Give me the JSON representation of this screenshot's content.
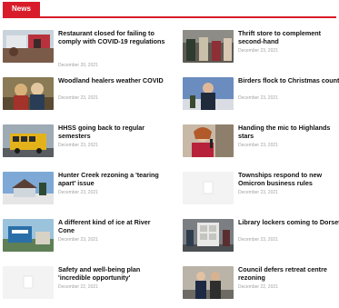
{
  "section": {
    "label": "News",
    "accent": "#d91c2a"
  },
  "articles": [
    {
      "headline": "Restaurant closed for failing to comply with COVID-19 regulations",
      "date": "December 20, 2021",
      "image": "restaurant-photo"
    },
    {
      "headline": "Thrift store to complement second-hand",
      "date": "December 23, 2021",
      "image": "thrift-store-photo"
    },
    {
      "headline": "Woodland healers weather COVID",
      "date": "December 23, 2021",
      "image": "woodland-photo"
    },
    {
      "headline": "Birders flock to Christmas count",
      "date": "December 23, 2021",
      "image": "birders-photo"
    },
    {
      "headline": "HHSS going back to regular semesters",
      "date": "December 23, 2021",
      "image": "school-bus-photo"
    },
    {
      "headline": "Handing the mic to Highlands stars",
      "date": "December 23, 2021",
      "image": "microphone-photo"
    },
    {
      "headline": "Hunter Creek rezoning a 'tearing apart' issue",
      "date": "December 23, 2021",
      "image": "hunter-creek-photo"
    },
    {
      "headline": "Townships respond to new Omicron business rules",
      "date": "December 23, 2021",
      "image": ""
    },
    {
      "headline": "A different kind of ice at River Cone",
      "date": "December 23, 2021",
      "image": "river-cone-photo"
    },
    {
      "headline": "Library lockers coming to Dorset",
      "date": "December 23, 2021",
      "image": "library-photo"
    },
    {
      "headline": "Safety and well-being plan 'incredible opportunity'",
      "date": "December 22, 2021",
      "image": ""
    },
    {
      "headline": "Council defers retreat centre rezoning",
      "date": "December 22, 2021",
      "image": "council-photo"
    }
  ]
}
